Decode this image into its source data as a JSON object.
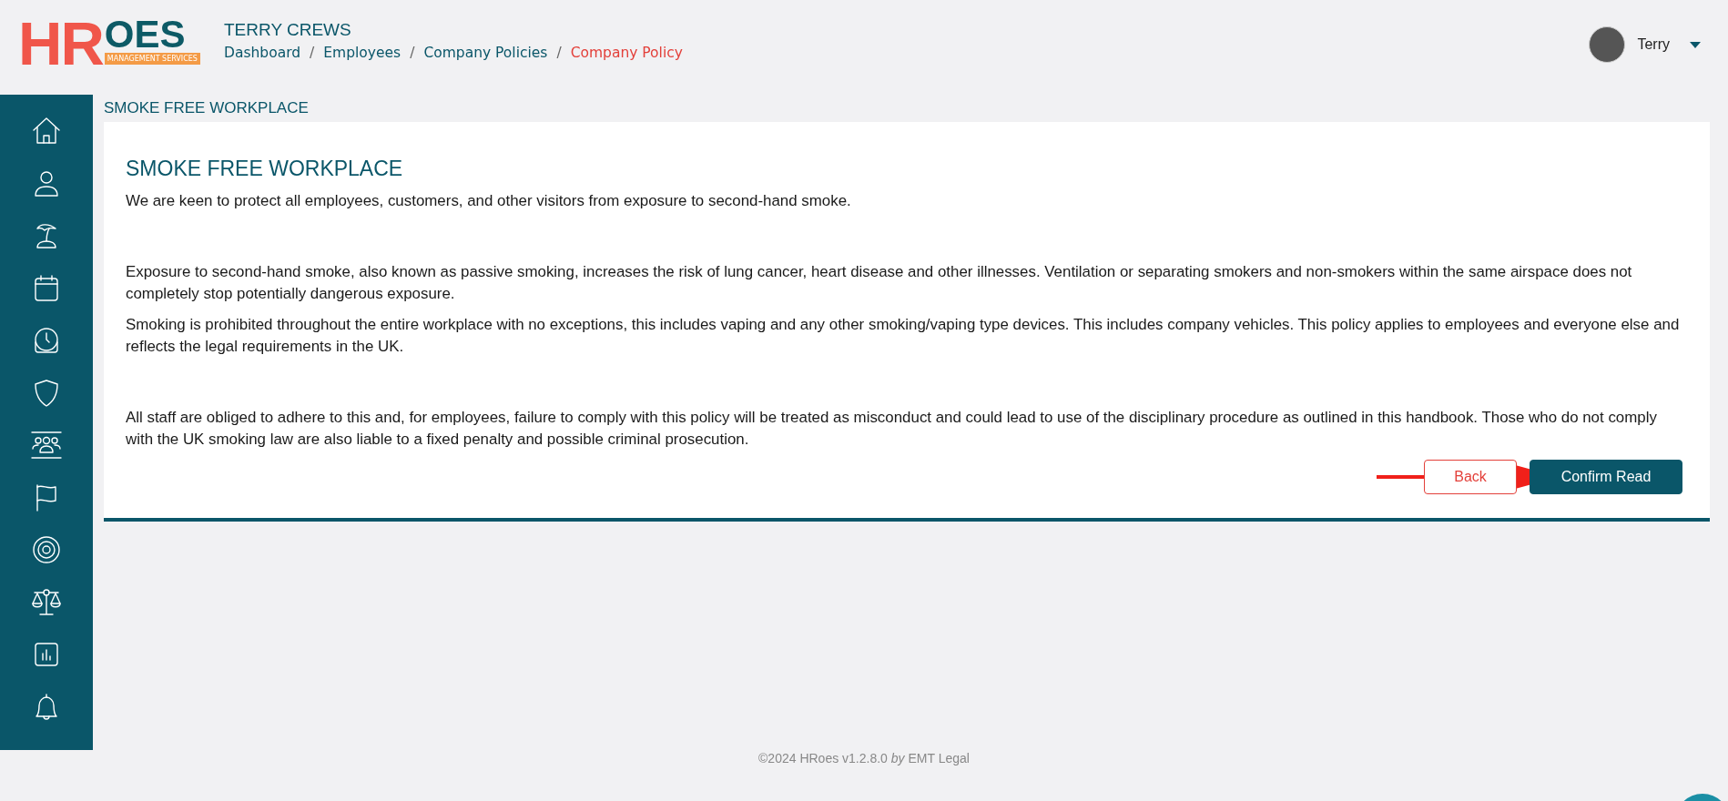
{
  "logo": {
    "first": "HR",
    "second": "OES",
    "tagline": "MANAGEMENT SERVICES"
  },
  "header": {
    "title": "TERRY CREWS",
    "breadcrumb": [
      {
        "label": "Dashboard",
        "selected": false
      },
      {
        "separator": "/",
        "label": "Employees",
        "selected": false
      },
      {
        "separator": "/",
        "label": "Company Policies",
        "selected": false
      },
      {
        "separator": "/",
        "label": "Company Policy",
        "selected": true
      }
    ]
  },
  "user": {
    "name": "Terry"
  },
  "sidebar": {
    "items": [
      {
        "kind": "home"
      },
      {
        "kind": "person"
      },
      {
        "kind": "island"
      },
      {
        "kind": "calendar"
      },
      {
        "kind": "clock"
      },
      {
        "kind": "shield"
      },
      {
        "kind": "team"
      },
      {
        "kind": "flag"
      },
      {
        "kind": "target"
      },
      {
        "kind": "scales"
      },
      {
        "kind": "chart"
      },
      {
        "kind": "bell"
      }
    ]
  },
  "page_title": "SMOKE FREE WORKPLACE",
  "policy": {
    "title": "SMOKE FREE WORKPLACE",
    "paragraphs": [
      {
        "text": "We are keen to protect all employees, customers, and other visitors from exposure to second-hand smoke."
      },
      {
        "text": "Exposure to second-hand smoke, also known as passive smoking, increases the risk of lung cancer, heart disease and other illnesses. Ventilation or separating smokers and non-smokers within the same airspace does not completely stop potentially dangerous exposure."
      },
      {
        "text": "Smoking is prohibited throughout the entire workplace with no exceptions, this includes vaping and any other smoking/vaping type devices. This includes company vehicles. This policy applies to employees and everyone else and reflects the legal requirements in the UK."
      },
      {
        "text": "All staff are obliged to adhere to this and, for employees, failure to comply with this policy will be treated as misconduct and could lead to use of the disciplinary procedure as outlined in this handbook.  Those who do not comply with the UK smoking law are also liable to a fixed penalty and possible criminal prosecution."
      }
    ],
    "buttons": [
      {
        "label": "Back",
        "kind": "outline"
      },
      {
        "label": "Confirm Read",
        "kind": "primary"
      }
    ]
  },
  "footer": "©2024 HRoes v1.2.8.0 *by* EMT Legal"
}
